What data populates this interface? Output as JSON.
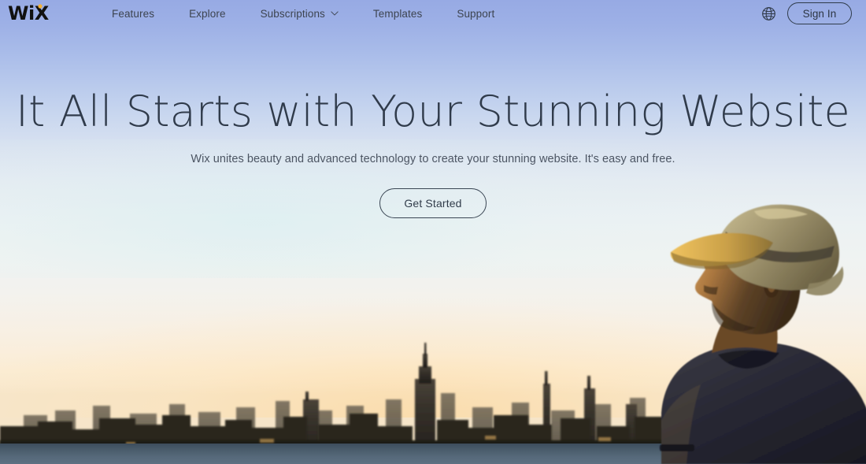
{
  "brand": {
    "logo_text": "WiX",
    "logo_dot_color": "#f5b335",
    "logo_color": "#111111"
  },
  "nav": {
    "items": [
      {
        "label": "Features",
        "icon": null,
        "name": "nav-item-features"
      },
      {
        "label": "Explore",
        "icon": null,
        "name": "nav-item-explore"
      },
      {
        "label": "Subscriptions",
        "icon": "chevron-down-icon",
        "name": "nav-item-subscriptions"
      },
      {
        "label": "Templates",
        "icon": null,
        "name": "nav-item-templates"
      },
      {
        "label": "Support",
        "icon": null,
        "name": "nav-item-support"
      }
    ],
    "language_icon": "globe-icon",
    "signin_label": "Sign In",
    "text_color": "#3d4450"
  },
  "hero": {
    "title": "It All Starts with Your Stunning Website",
    "subtitle": "Wix unites beauty and advanced technology to create your stunning website. It's easy and free.",
    "cta_label": "Get Started",
    "title_color": "#303b4b",
    "subtitle_color": "#4c5563"
  },
  "background": {
    "description": "Sunset sky over New York City skyline with a man in a straw hat in profile",
    "sky_top_color": "#97aae4",
    "sky_mid_color": "#eaf2f4",
    "sky_horizon_color": "#f9eedd",
    "skyline_color": "#2a2620",
    "water_color": "#4a5c6b",
    "landmark": "Empire State Building"
  }
}
